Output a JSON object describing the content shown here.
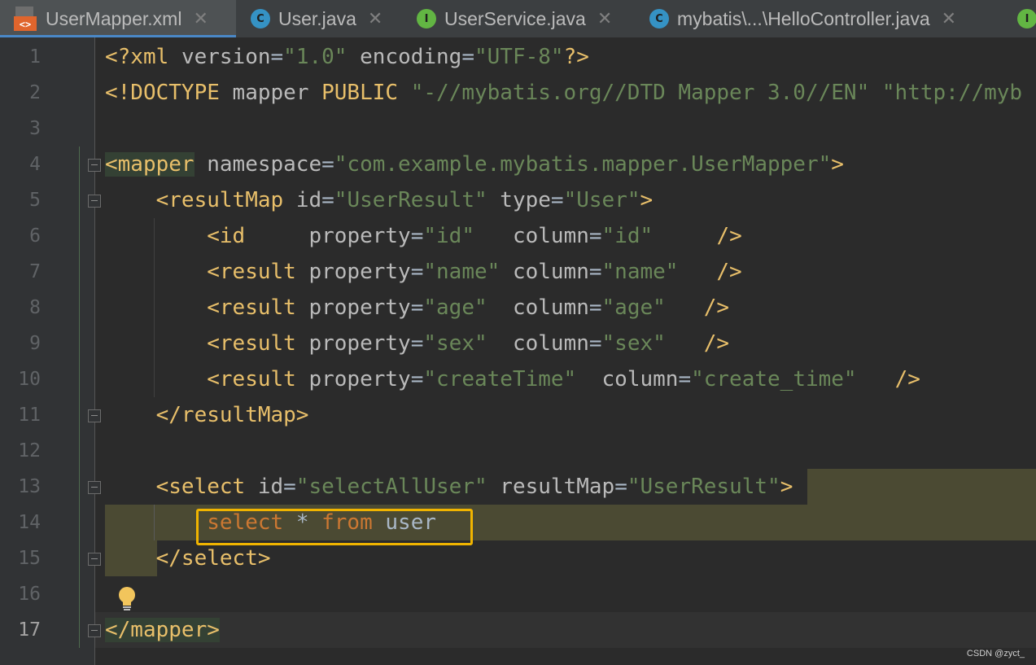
{
  "tabs": [
    {
      "label": "UserMapper.xml",
      "icon": "xml-file-icon",
      "active": true
    },
    {
      "label": "User.java",
      "icon": "class-icon"
    },
    {
      "label": "UserService.java",
      "icon": "interface-icon"
    },
    {
      "label": "mybatis\\...\\HelloController.java",
      "icon": "class-icon"
    }
  ],
  "close_glyph": "✕",
  "lines": [
    {
      "n": "1"
    },
    {
      "n": "2"
    },
    {
      "n": "3"
    },
    {
      "n": "4"
    },
    {
      "n": "5"
    },
    {
      "n": "6"
    },
    {
      "n": "7"
    },
    {
      "n": "8"
    },
    {
      "n": "9"
    },
    {
      "n": "10"
    },
    {
      "n": "11"
    },
    {
      "n": "12"
    },
    {
      "n": "13"
    },
    {
      "n": "14"
    },
    {
      "n": "15"
    },
    {
      "n": "16"
    },
    {
      "n": "17"
    }
  ],
  "code": {
    "l1": {
      "open": "<?xml",
      "a1": "version",
      "v1": "\"1.0\"",
      "a2": "encoding",
      "v2": "\"UTF-8\"",
      "close": "?>"
    },
    "l2": {
      "doctype": "<!DOCTYPE",
      "name": "mapper",
      "kw": "PUBLIC",
      "s1": "\"-//mybatis.org//DTD Mapper 3.0//EN\"",
      "s2": "\"http://myb"
    },
    "l4": {
      "tag": "<mapper",
      "attr": "namespace",
      "val": "\"com.example.mybatis.mapper.UserMapper\"",
      "close": ">"
    },
    "l5": {
      "tag": "<resultMap",
      "a1": "id",
      "v1": "\"UserResult\"",
      "a2": "type",
      "v2": "\"User\"",
      "close": ">"
    },
    "l6": {
      "tag": "<id",
      "a1": "property",
      "v1": "\"id\"",
      "a2": "column",
      "v2": "\"id\"",
      "close": "/>"
    },
    "l7": {
      "tag": "<result",
      "a1": "property",
      "v1": "\"name\"",
      "a2": "column",
      "v2": "\"name\"",
      "close": "/>"
    },
    "l8": {
      "tag": "<result",
      "a1": "property",
      "v1": "\"age\"",
      "a2": "column",
      "v2": "\"age\"",
      "close": "/>"
    },
    "l9": {
      "tag": "<result",
      "a1": "property",
      "v1": "\"sex\"",
      "a2": "column",
      "v2": "\"sex\"",
      "close": "/>"
    },
    "l10": {
      "tag": "<result",
      "a1": "property",
      "v1": "\"createTime\"",
      "a2": "column",
      "v2": "\"create_time\"",
      "close": "/>"
    },
    "l11": {
      "tag": "</resultMap>"
    },
    "l13": {
      "tag": "<select",
      "a1": "id",
      "v1": "\"selectAllUser\"",
      "a2": "resultMap",
      "v2": "\"UserResult\"",
      "close": ">"
    },
    "l14": {
      "kw1": "select",
      "star": "*",
      "kw2": "from",
      "table": "user"
    },
    "l15": {
      "tag": "</select>"
    },
    "l17": {
      "tag": "</mapper",
      "close": ">"
    }
  },
  "watermark": "CSDN @zyct_",
  "colors": {
    "tag": "#e8bf6a",
    "string": "#6a8759",
    "keyword": "#cc7832",
    "highlight_box": "#f0b400"
  }
}
